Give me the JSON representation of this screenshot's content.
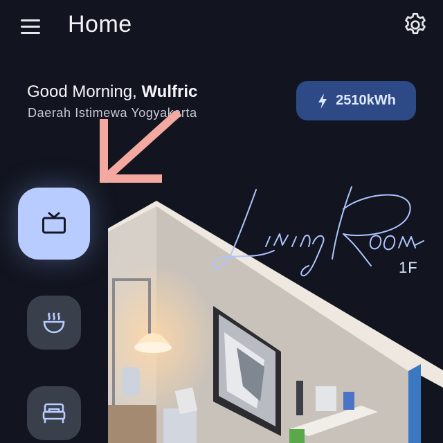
{
  "header": {
    "title": "Home",
    "menu_icon": "hamburger-menu-icon",
    "settings_icon": "gear-icon"
  },
  "greeting": {
    "prefix": "Good Morning,",
    "name": "Wulfric",
    "location": "Daerah Istimewa Yogyakarta"
  },
  "energy": {
    "value": "2510kWh",
    "icon": "lightning-bolt-icon"
  },
  "room": {
    "name": "Living Room",
    "floor": "1F"
  },
  "rooms_nav": [
    {
      "icon": "tv-icon",
      "selected": true
    },
    {
      "icon": "bowl-icon",
      "selected": false
    },
    {
      "icon": "bed-icon",
      "selected": false
    }
  ],
  "colors": {
    "background": "#12151f",
    "energy_badge": "#2d4a86",
    "selected_room": "#b8ccff",
    "room_button": "#3a3f4c",
    "annotation_arrow": "#f4a9a0",
    "room_title": "#aec4ff"
  }
}
